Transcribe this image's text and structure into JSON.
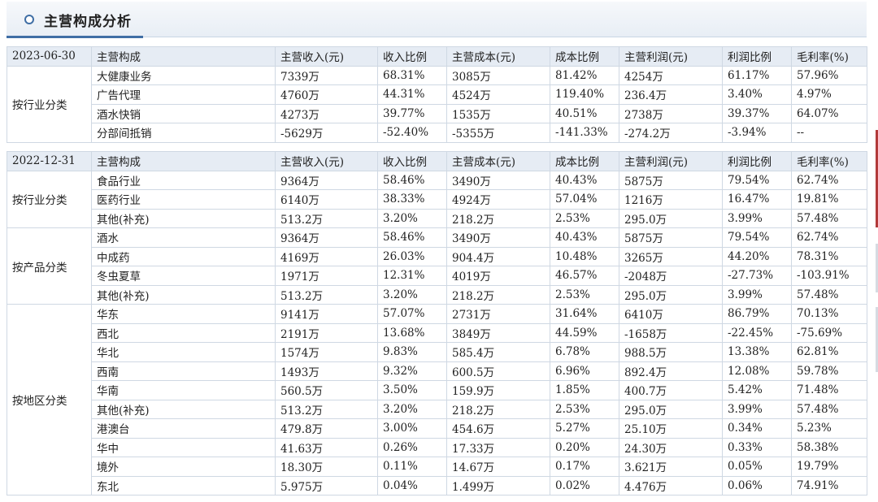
{
  "page_title": "主营构成分析",
  "columns": [
    "主营构成",
    "主营收入(元)",
    "收入比例",
    "主营成本(元)",
    "成本比例",
    "主营利润(元)",
    "利润比例",
    "毛利率(%)"
  ],
  "periods": [
    {
      "date": "2023-06-30",
      "groups": [
        {
          "label": "按行业分类",
          "rows": [
            [
              "大健康业务",
              "7339万",
              "68.31%",
              "3085万",
              "81.42%",
              "4254万",
              "61.17%",
              "57.96%"
            ],
            [
              "广告代理",
              "4760万",
              "44.31%",
              "4524万",
              "119.40%",
              "236.4万",
              "3.40%",
              "4.97%"
            ],
            [
              "酒水快销",
              "4273万",
              "39.77%",
              "1535万",
              "40.51%",
              "2738万",
              "39.37%",
              "64.07%"
            ],
            [
              "分部间抵销",
              "-5629万",
              "-52.40%",
              "-5355万",
              "-141.33%",
              "-274.2万",
              "-3.94%",
              "--"
            ]
          ]
        }
      ]
    },
    {
      "date": "2022-12-31",
      "groups": [
        {
          "label": "按行业分类",
          "rows": [
            [
              "食品行业",
              "9364万",
              "58.46%",
              "3490万",
              "40.43%",
              "5875万",
              "79.54%",
              "62.74%"
            ],
            [
              "医药行业",
              "6140万",
              "38.33%",
              "4924万",
              "57.04%",
              "1216万",
              "16.47%",
              "19.81%"
            ],
            [
              "其他(补充)",
              "513.2万",
              "3.20%",
              "218.2万",
              "2.53%",
              "295.0万",
              "3.99%",
              "57.48%"
            ]
          ]
        },
        {
          "label": "按产品分类",
          "rows": [
            [
              "酒水",
              "9364万",
              "58.46%",
              "3490万",
              "40.43%",
              "5875万",
              "79.54%",
              "62.74%"
            ],
            [
              "中成药",
              "4169万",
              "26.03%",
              "904.4万",
              "10.48%",
              "3265万",
              "44.20%",
              "78.31%"
            ],
            [
              "冬虫夏草",
              "1971万",
              "12.31%",
              "4019万",
              "46.57%",
              "-2048万",
              "-27.73%",
              "-103.91%"
            ],
            [
              "其他(补充)",
              "513.2万",
              "3.20%",
              "218.2万",
              "2.53%",
              "295.0万",
              "3.99%",
              "57.48%"
            ]
          ]
        },
        {
          "label": "按地区分类",
          "rows": [
            [
              "华东",
              "9141万",
              "57.07%",
              "2731万",
              "31.64%",
              "6410万",
              "86.79%",
              "70.13%"
            ],
            [
              "西北",
              "2191万",
              "13.68%",
              "3849万",
              "44.59%",
              "-1658万",
              "-22.45%",
              "-75.69%"
            ],
            [
              "华北",
              "1574万",
              "9.83%",
              "585.4万",
              "6.78%",
              "988.5万",
              "13.38%",
              "62.81%"
            ],
            [
              "西南",
              "1493万",
              "9.32%",
              "600.5万",
              "6.96%",
              "892.4万",
              "12.08%",
              "59.78%"
            ],
            [
              "华南",
              "560.5万",
              "3.50%",
              "159.9万",
              "1.85%",
              "400.7万",
              "5.42%",
              "71.48%"
            ],
            [
              "其他(补充)",
              "513.2万",
              "3.20%",
              "218.2万",
              "2.53%",
              "295.0万",
              "3.99%",
              "57.48%"
            ],
            [
              "港澳台",
              "479.8万",
              "3.00%",
              "454.6万",
              "5.27%",
              "25.10万",
              "0.34%",
              "5.23%"
            ],
            [
              "华中",
              "41.63万",
              "0.26%",
              "17.33万",
              "0.20%",
              "24.30万",
              "0.33%",
              "58.38%"
            ],
            [
              "境外",
              "18.30万",
              "0.11%",
              "14.67万",
              "0.17%",
              "3.621万",
              "0.05%",
              "19.79%"
            ],
            [
              "东北",
              "5.975万",
              "0.04%",
              "1.499万",
              "0.02%",
              "4.476万",
              "0.06%",
              "74.91%"
            ]
          ]
        }
      ]
    }
  ]
}
